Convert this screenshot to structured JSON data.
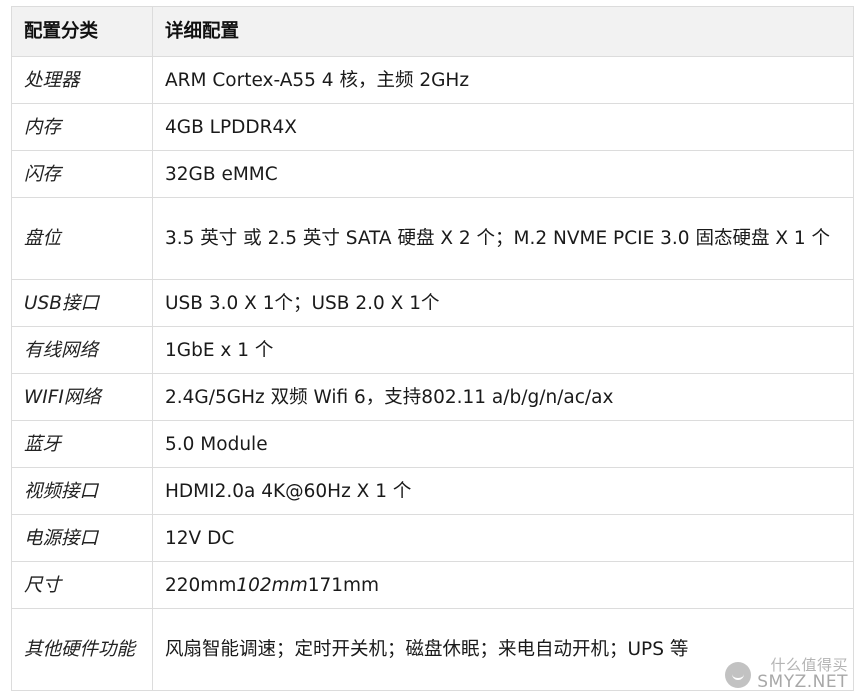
{
  "table": {
    "headers": [
      "配置分类",
      "详细配置"
    ],
    "rows": [
      {
        "category": "处理器",
        "detail": "ARM Cortex-A55 4 核，主频 2GHz"
      },
      {
        "category": "内存",
        "detail": "4GB LPDDR4X"
      },
      {
        "category": "闪存",
        "detail": "32GB eMMC"
      },
      {
        "category": "盘位",
        "detail": "3.5 英寸 或 2.5 英寸 SATA 硬盘 X 2 个；M.2 NVME PCIE 3.0 固态硬盘 X 1 个"
      },
      {
        "category": "USB接口",
        "detail": "USB 3.0 X 1个；USB 2.0 X 1个"
      },
      {
        "category": "有线网络",
        "detail": "1GbE x 1 个"
      },
      {
        "category": "WIFI网络",
        "detail": "2.4G/5GHz 双频 Wifi 6，支持802.11 a/b/g/n/ac/ax"
      },
      {
        "category": "蓝牙",
        "detail": "5.0 Module"
      },
      {
        "category": "视频接口",
        "detail": "HDMI2.0a 4K@60Hz X 1 个"
      },
      {
        "category": "电源接口",
        "detail": "12V DC"
      },
      {
        "category": "尺寸",
        "detail_parts": [
          "220mm",
          "102mm",
          "171mm"
        ]
      },
      {
        "category": "其他硬件功能",
        "detail": "风扇智能调速；定时开关机；磁盘休眠；来电自动开机；UPS 等"
      }
    ]
  },
  "watermark": {
    "top": "什么值得买",
    "text": "SMYZ.NET",
    "logo_icon": "smile-logo-icon"
  }
}
